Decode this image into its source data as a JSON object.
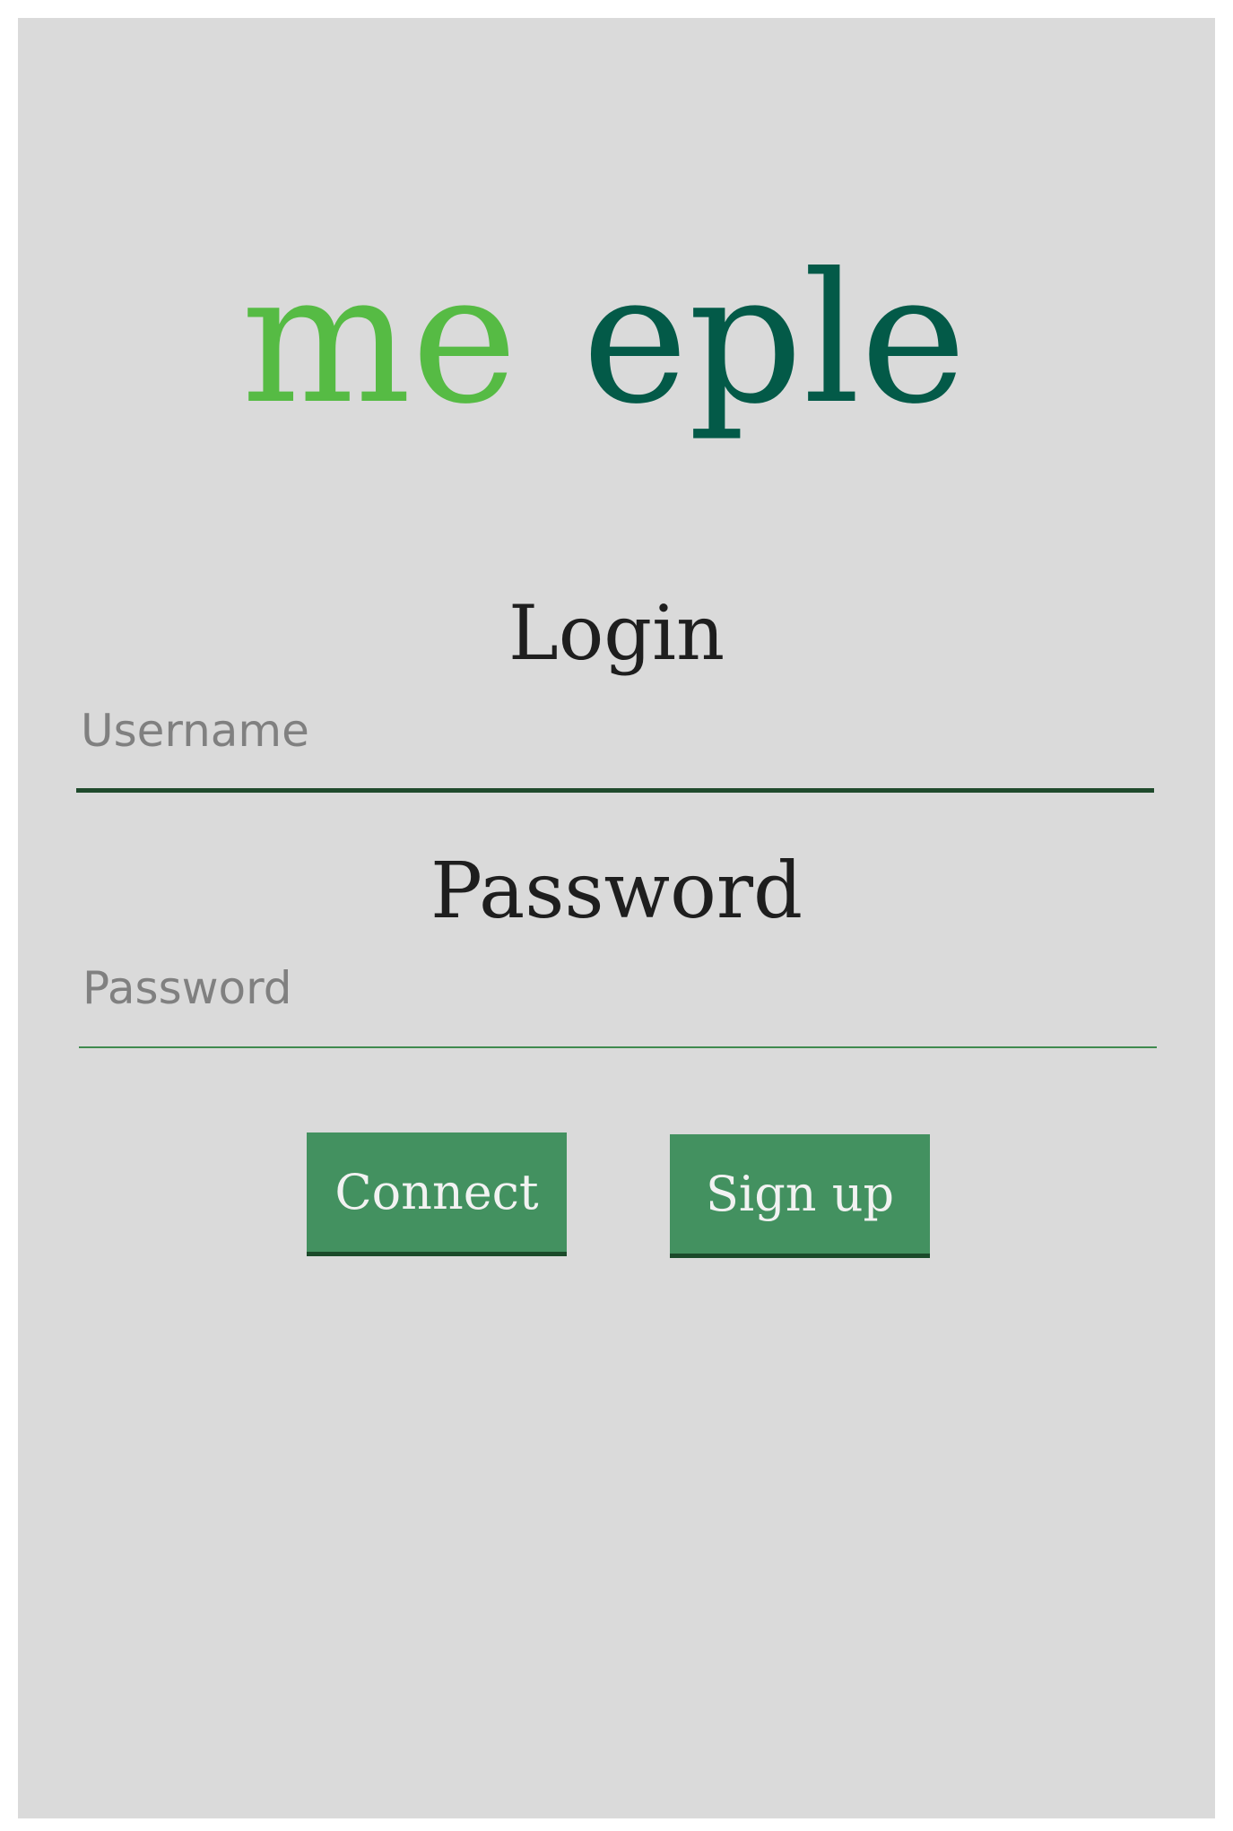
{
  "app": {
    "logo_text": "meeple",
    "logo_colors": {
      "light_green": "#56bb44",
      "dark_green": "#035a48"
    }
  },
  "login_form": {
    "title": "Login",
    "username_placeholder": "Username",
    "password_label": "Password",
    "password_placeholder": "Password",
    "connect_label": "Connect",
    "signup_label": "Sign up"
  },
  "colors": {
    "background": "#dadada",
    "button": "#439160",
    "button_text": "#f2f2f2",
    "input_underline": "#1f4a2c"
  }
}
